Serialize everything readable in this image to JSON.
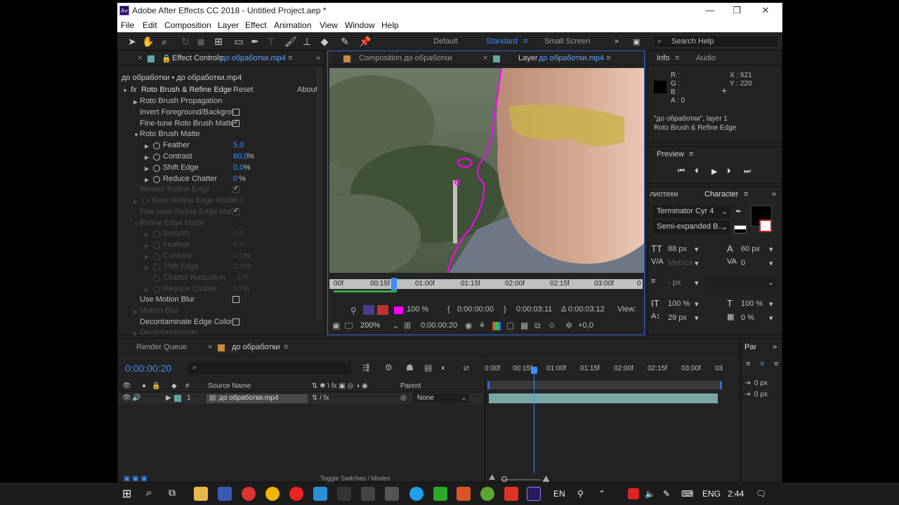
{
  "window": {
    "title": "Adobe After Effects CC 2018 - Untitled Project.aep *",
    "logo": "Ae",
    "controls": [
      "minimize-icon",
      "maximize-icon",
      "close-icon"
    ]
  },
  "menu": [
    "File",
    "Edit",
    "Composition",
    "Layer",
    "Effect",
    "Animation",
    "View",
    "Window",
    "Help"
  ],
  "workspaces": {
    "default": "Default",
    "standard": "Standard",
    "small_screen": "Small Screen",
    "search_placeholder": "Search Help"
  },
  "effect_controls": {
    "tab_label": "Effect Controls",
    "tab_layer": "до обработки.mp4",
    "breadcrumb": "до обработки • до обработки.mp4",
    "effect_name": "Roto Brush & Refine Edge",
    "reset": "Reset",
    "about": "About",
    "rows": {
      "propagation": "Roto Brush Propagation",
      "invert": "Invert Foreground/Backgrou",
      "finetune": "Fine-tune Roto Brush Matte",
      "matte": "Roto Brush Matte",
      "feather": "Feather",
      "feather_val": "5,0",
      "contrast": "Contrast",
      "contrast_val": "80,0",
      "shift": "Shift Edge",
      "shift_val": "0,0",
      "chatter": "Reduce Chatter",
      "chatter_val": "0",
      "render_refine": "Render Refine Edge",
      "base_radius": "Base Refine Edge Radiu",
      "base_radius_val": "0,0",
      "finetune_refine": "Fine-tune Refine Edge Matt",
      "refine_matte": "Refine Edge Matte",
      "r_smooth": "Smooth",
      "r_smooth_val": "0,0",
      "r_feather": "Feather",
      "r_feather_val": "0,0",
      "r_contrast": "Contrast",
      "r_contrast_val": "0,0",
      "r_shift": "Shift Edge",
      "r_shift_val": "0,0",
      "r_chatter_red": "Chatter Reduction",
      "r_chatter_red_val": "Off",
      "r_reduce": "Reduce Chatter",
      "r_reduce_val": "50",
      "motion_blur_use": "Use Motion Blur",
      "motion_blur": "Motion Blur",
      "decontaminate": "Decontaminate Edge Colors",
      "decontamination": "Decontamination"
    },
    "units": {
      "percent": "%"
    }
  },
  "viewer": {
    "comp_tab": "Composition до обработки",
    "layer_tab_label": "Layer",
    "layer_tab_name": "до обработки.mp4",
    "ruler_ticks": [
      "00f",
      "00:15f",
      "01:00f",
      "01:15f",
      "02:00f",
      "02:15f",
      "03:00f",
      "0"
    ],
    "fg_pct": "100 %",
    "tc_in": "0:00:00:00",
    "tc_out": "0:00:03:11",
    "tc_dur": "Δ 0:00:03:12",
    "view_label": "View:",
    "zoom": "200%",
    "current_time": "0:00:00:20",
    "exposure": "+0,0"
  },
  "info": {
    "tab_info": "Info",
    "tab_audio": "Audio",
    "r": "R :",
    "g": "G :",
    "b": "B :",
    "a": "A : 0",
    "x": "X : 621",
    "y": "Y : 220",
    "layer_line": "\"до обработки\", layer 1",
    "effect_line": "Roto Brush & Refine Edge"
  },
  "preview": {
    "label": "Preview"
  },
  "character": {
    "tab_libraries": "лиотеки",
    "tab_character": "Character",
    "font": "Terminator Cyr 4",
    "style": "Semi-expanded B...",
    "size": "88 px",
    "leading": "60 px",
    "kerning": "Metrics",
    "tracking": "0",
    "stroke": "- px",
    "vscale": "100 %",
    "hscale": "100 %",
    "baseline": "29 px",
    "tsume": "0 %"
  },
  "timeline": {
    "render_queue": "Render Queue",
    "comp_tab": "до обработки",
    "timecode": "0:00:00:20",
    "search_placeholder": "⌕",
    "col_source": "Source Name",
    "col_parent": "Parent",
    "col_hash": "#",
    "layer_num": "1",
    "layer_name": "до обработки.mp4",
    "parent_val": "None",
    "ticks": [
      "0:00f",
      "00:15f",
      "01:00f",
      "01:15f",
      "02:00f",
      "02:15f",
      "03:00f",
      "03"
    ],
    "toggle_label": "Toggle Switches / Modes"
  },
  "paragraph": {
    "tab": "Par",
    "indent1": "0 px",
    "indent2": "0 px"
  },
  "taskbar": {
    "lang": "EN",
    "lang2": "ENG",
    "time": "2:44"
  }
}
